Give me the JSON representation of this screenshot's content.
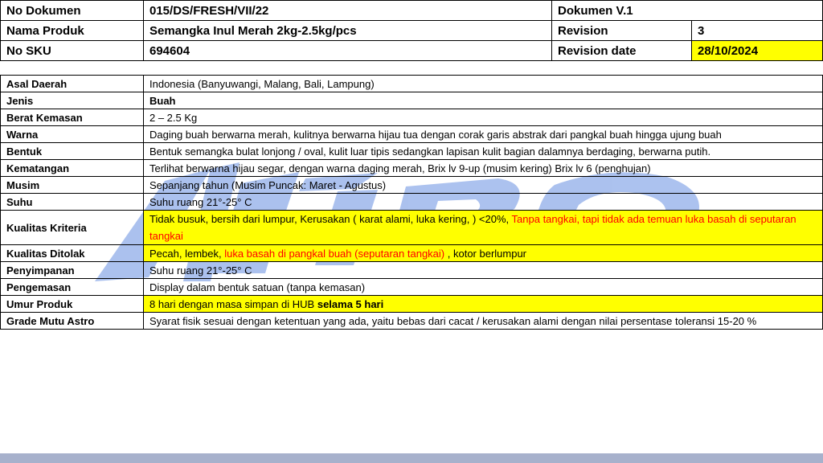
{
  "header": {
    "no_dokumen_label": "No Dokumen",
    "no_dokumen_value": "015/DS/FRESH/VII/22",
    "dokumen_version": "Dokumen V.1",
    "nama_produk_label": "Nama Produk",
    "nama_produk_value": "Semangka Inul Merah 2kg-2.5kg/pcs",
    "revision_label": "Revision",
    "revision_value": "3",
    "no_sku_label": "No SKU",
    "no_sku_value": "694604",
    "revision_date_label": "Revision date",
    "revision_date_value": "28/10/2024"
  },
  "spec": {
    "asal_daerah": {
      "label": "Asal Daerah",
      "value": "Indonesia (Banyuwangi, Malang, Bali, Lampung)"
    },
    "jenis": {
      "label": "Jenis",
      "value": "Buah"
    },
    "berat_kemasan": {
      "label": "Berat Kemasan",
      "value": "2 – 2.5 Kg"
    },
    "warna": {
      "label": "Warna",
      "value": "Daging buah berwarna merah, kulitnya berwarna hijau tua dengan corak garis abstrak dari pangkal buah hingga ujung buah"
    },
    "bentuk": {
      "label": "Bentuk",
      "value": "Bentuk semangka bulat lonjong / oval, kulit luar tipis sedangkan lapisan kulit bagian dalamnya berdaging, berwarna putih."
    },
    "kematangan": {
      "label": "Kematangan",
      "value": "Terlihat berwarna hijau segar, dengan warna daging merah, Brix lv 9-up (musim kering) Brix lv 6 (penghujan)"
    },
    "musim": {
      "label": "Musim",
      "value": "Sepanjang tahun (Musim Puncak: Maret - Agustus)"
    },
    "suhu": {
      "label": "Suhu",
      "value": "Suhu ruang 21°-25° C"
    },
    "kualitas_kriteria": {
      "label": "Kualitas Kriteria",
      "value_black": "Tidak busuk, bersih dari lumpur, Kerusakan ( karat alami, luka kering, ) <20%, ",
      "value_red": "Tanpa tangkai, tapi tidak ada temuan luka basah di seputaran tangkai"
    },
    "kualitas_ditolak": {
      "label": "Kualitas Ditolak",
      "value_black_1": "Pecah, lembek, ",
      "value_red": "luka basah di pangkal buah (seputaran tangkai)",
      "value_black_2": " , kotor berlumpur"
    },
    "penyimpanan": {
      "label": "Penyimpanan",
      "value": "Suhu ruang 21°-25° C"
    },
    "pengemasan": {
      "label": "Pengemasan",
      "value": "Display dalam bentuk satuan (tanpa kemasan)"
    },
    "umur_produk": {
      "label": "Umur Produk",
      "value_normal": "8 hari dengan masa simpan di HUB ",
      "value_bold": "selama 5  hari"
    },
    "grade_mutu": {
      "label": "Grade Mutu Astro",
      "value": "Syarat fisik sesuai dengan ketentuan yang ada, yaitu bebas dari cacat / kerusakan alami dengan  nilai persentase toleransi 15-20 %"
    }
  },
  "colors": {
    "highlight": "#ffff00",
    "red_text": "#ff0000",
    "watermark": "#9db7ec",
    "footer_bar": "#a7b1cc"
  },
  "icons": {
    "watermark": "astro-logo-watermark"
  }
}
